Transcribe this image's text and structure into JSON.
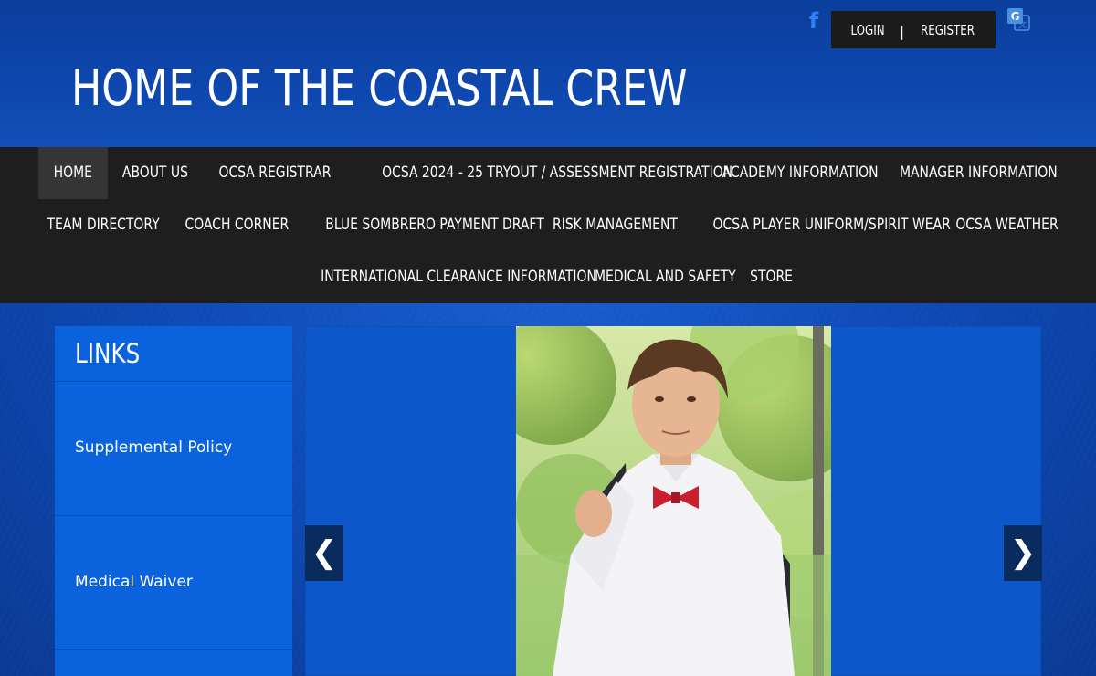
{
  "header": {
    "site_title": "HOME OF THE COASTAL CREW",
    "auth": {
      "login": "LOGIN",
      "separator": "|",
      "register": "REGISTER"
    },
    "social_icon": "facebook-icon",
    "translate_icon": "google-translate-icon"
  },
  "nav": {
    "rows": [
      [
        "HOME",
        "ABOUT US",
        "OCSA REGISTRAR",
        "OCSA 2024 - 25 TRYOUT / ASSESSMENT REGISTRATION",
        "ACADEMY INFORMATION",
        "MANAGER INFORMATION"
      ],
      [
        "TEAM DIRECTORY",
        "COACH CORNER",
        "BLUE SOMBRERO PAYMENT DRAFT",
        "RISK MANAGEMENT",
        "OCSA PLAYER UNIFORM/SPIRIT WEAR",
        "OCSA WEATHER"
      ],
      [
        "INTERNATIONAL CLEARANCE INFORMATION",
        "MEDICAL AND SAFETY",
        "STORE"
      ]
    ],
    "active": "HOME"
  },
  "sidebar": {
    "title": "LINKS",
    "links": [
      "Supplemental Policy",
      "Medical Waiver"
    ]
  },
  "slider": {
    "prev_glyph": "❮",
    "next_glyph": "❯"
  },
  "colors": {
    "background_blue": "#0f4bb8",
    "nav_bg": "#1e1e1e",
    "nav_active": "#353535",
    "sidebar_bg": "#0a63dc",
    "arrow_bg": "#0a2b5e",
    "facebook_blue": "#2f7cf5"
  }
}
